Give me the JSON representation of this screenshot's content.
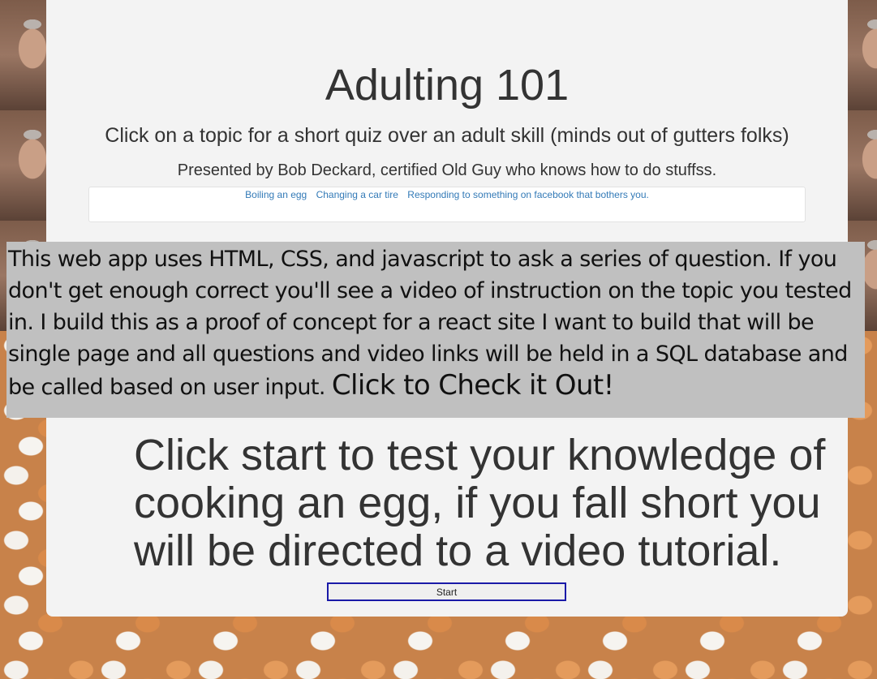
{
  "header": {
    "title": "Adulting 101",
    "subtitle": "Click on a topic for a short quiz over an adult skill (minds out of gutters folks)",
    "presenter": "Presented by Bob Deckard, certified Old Guy who knows how to do stuffss."
  },
  "topics": [
    {
      "label": "Boiling an egg"
    },
    {
      "label": "Changing a car tire"
    },
    {
      "label": "Responding to something on facebook that bothers you."
    }
  ],
  "info": {
    "text": "This web app uses HTML, CSS, and javascript to ask a series of question. If you don't get enough correct you'll see a video of instruction on the topic you tested in. I build this as a proof of concept for a react site I want to build that will be single page and all questions and video links will be held in a SQL database and be called based on user input.",
    "cta": "Click to Check it Out!"
  },
  "quiz": {
    "intro": "Click start to test your knowledge of cooking an egg, if you fall short you will be directed to a video tutorial.",
    "start_label": "Start"
  }
}
